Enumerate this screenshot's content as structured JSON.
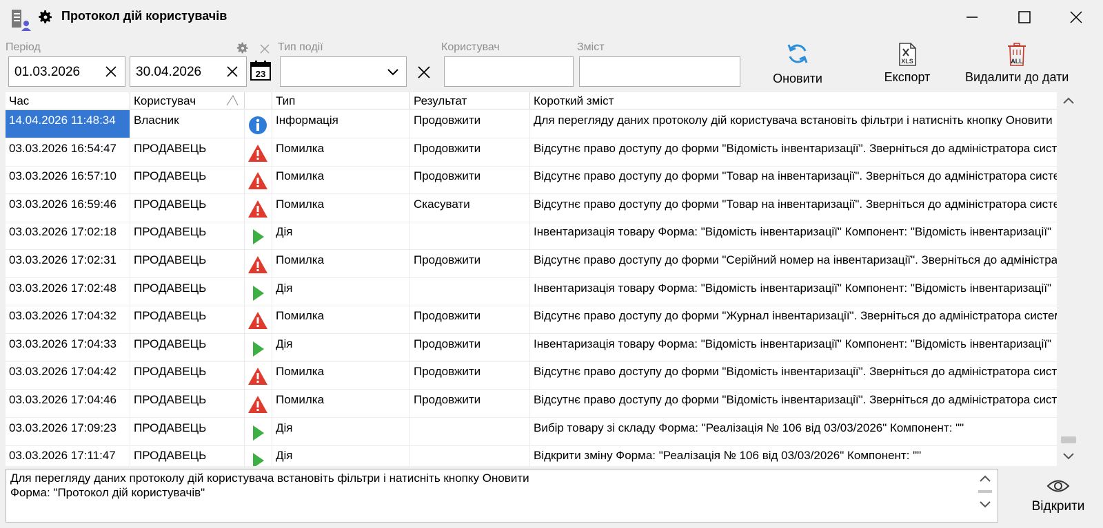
{
  "window": {
    "title": "Протокол дій користувачів",
    "icons": [
      "user-log-icon",
      "gear-icon"
    ],
    "controls": [
      "minimize-icon",
      "maximize-icon",
      "close-icon"
    ]
  },
  "filters": {
    "period_label": "Період",
    "date_from": "01.03.2026",
    "date_to": "30.04.2026",
    "event_type_label": "Тип події",
    "event_type_value": "",
    "user_label": "Користувач",
    "user_value": "",
    "content_label": "Зміст",
    "content_value": ""
  },
  "toolbar": {
    "refresh_label": "Оновити",
    "export_label": "Експорт",
    "delete_label": "Видалити до дати"
  },
  "grid": {
    "columns": [
      "Час",
      "Користувач",
      "",
      "Тип",
      "Результат",
      "Короткий зміст"
    ],
    "sorted_column": "Користувач",
    "rows": [
      {
        "time": "14.04.2026 11:48:34",
        "user": "Власник",
        "icon": "info",
        "type": "Інформація",
        "result": "Продовжити",
        "summary": "Для перегляду даних протоколу дій користувача встановіть фільтри і натисніть кнопку Оновити"
      },
      {
        "time": "03.03.2026 16:54:47",
        "user": "ПРОДАВЕЦЬ",
        "icon": "error",
        "type": "Помилка",
        "result": "Продовжити",
        "summary": "Відсутнє право доступу до форми \"Відомість інвентаризації\".  Зверніться до адміністратора системи"
      },
      {
        "time": "03.03.2026 16:57:10",
        "user": "ПРОДАВЕЦЬ",
        "icon": "error",
        "type": "Помилка",
        "result": "Продовжити",
        "summary": "Відсутнє право доступу до форми \"Товар на інвентаризації\".  Зверніться до адміністратора системи"
      },
      {
        "time": "03.03.2026 16:59:46",
        "user": "ПРОДАВЕЦЬ",
        "icon": "error",
        "type": "Помилка",
        "result": "Скасувати",
        "summary": "Відсутнє право доступу до форми \"Товар на інвентаризації\".  Зверніться до адміністратора системи"
      },
      {
        "time": "03.03.2026 17:02:18",
        "user": "ПРОДАВЕЦЬ",
        "icon": "action",
        "type": "Дія",
        "result": "",
        "summary": "Інвентаризація товару  Форма: \"Відомість інвентаризації\"  Компонент: \"Відомість інвентаризації\""
      },
      {
        "time": "03.03.2026 17:02:31",
        "user": "ПРОДАВЕЦЬ",
        "icon": "error",
        "type": "Помилка",
        "result": "Продовжити",
        "summary": "Відсутнє право доступу до форми \"Серійний номер на інвентаризації\".  Зверніться до адміністратора"
      },
      {
        "time": "03.03.2026 17:02:48",
        "user": "ПРОДАВЕЦЬ",
        "icon": "action",
        "type": "Дія",
        "result": "",
        "summary": "Інвентаризація товару  Форма: \"Відомість інвентаризації\"  Компонент: \"Відомість інвентаризації\""
      },
      {
        "time": "03.03.2026 17:04:32",
        "user": "ПРОДАВЕЦЬ",
        "icon": "error",
        "type": "Помилка",
        "result": "Продовжити",
        "summary": "Відсутнє право доступу до форми \"Журнал інвентаризації\".  Зверніться до адміністратора системи"
      },
      {
        "time": "03.03.2026 17:04:33",
        "user": "ПРОДАВЕЦЬ",
        "icon": "action",
        "type": "Дія",
        "result": "Продовжити",
        "summary": "Інвентаризація товару  Форма: \"Відомість інвентаризації\"  Компонент: \"Відомість інвентаризації\""
      },
      {
        "time": "03.03.2026 17:04:42",
        "user": "ПРОДАВЕЦЬ",
        "icon": "error",
        "type": "Помилка",
        "result": "Продовжити",
        "summary": "Відсутнє право доступу до форми \"Відомість інвентаризації\".  Зверніться до адміністратора системи"
      },
      {
        "time": "03.03.2026 17:04:46",
        "user": "ПРОДАВЕЦЬ",
        "icon": "error",
        "type": "Помилка",
        "result": "Продовжити",
        "summary": "Відсутнє право доступу до форми \"Відомість інвентаризації\".  Зверніться до адміністратора системи"
      },
      {
        "time": "03.03.2026 17:09:23",
        "user": "ПРОДАВЕЦЬ",
        "icon": "action",
        "type": "Дія",
        "result": "",
        "summary": "Вибір товару зі складу  Форма: \"Реалізація № 106 від 03/03/2026\"  Компонент: \"\""
      },
      {
        "time": "03.03.2026 17:11:47",
        "user": "ПРОДАВЕЦЬ",
        "icon": "action",
        "type": "Дія",
        "result": "",
        "summary": "Відкрити зміну  Форма: \"Реалізація № 106 від 03/03/2026\"  Компонент: \"\""
      }
    ]
  },
  "details": {
    "line1": "Для перегляду даних протоколу дій користувача встановіть фільтри і натисніть кнопку Оновити",
    "line2": "Форма: \"Протокол дій користувачів\"",
    "open_label": "Відкрити"
  },
  "colors": {
    "selection": "#3478d4",
    "error": "#e03a2e",
    "action": "#3cb043",
    "info": "#2f7bd9",
    "refresh": "#2b8fd9",
    "delete": "#c0392b"
  }
}
